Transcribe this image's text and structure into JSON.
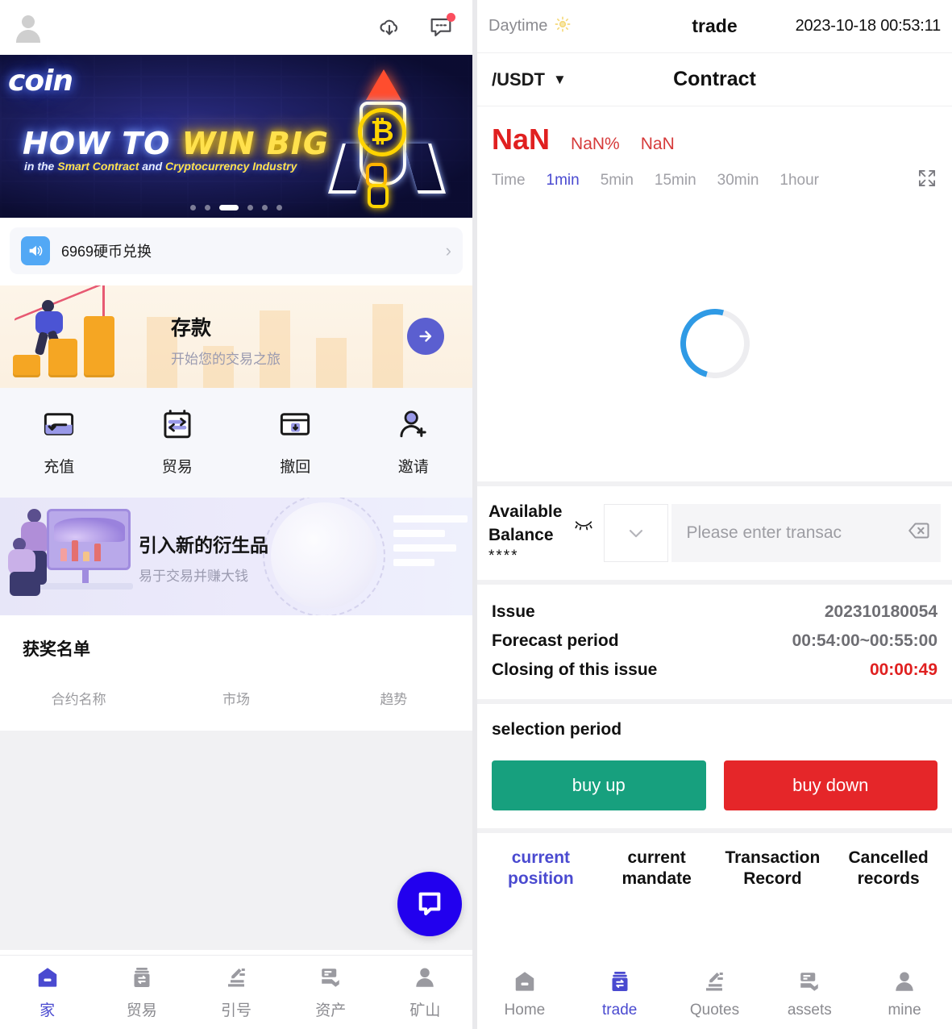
{
  "colors": {
    "brand_indigo": "#4a4ad0",
    "accent_periwinkle": "#9999e8",
    "buy_up_green": "#17a07e",
    "buy_down_red": "#e52629",
    "price_red": "#e02020",
    "fab_blue": "#2200ee",
    "notice_blue": "#52a8f5",
    "spinner_blue": "#2f9ae5"
  },
  "left": {
    "topbar": {
      "avatar_icon": "avatar-icon",
      "download_icon": "cloud-download-icon",
      "message_icon": "message-icon",
      "message_badge": true
    },
    "banner": {
      "logo": "coin",
      "headline_part1": "HOW TO ",
      "headline_highlight": "WIN BIG",
      "subline_pre": "in the ",
      "subline_hl1": "Smart Contract",
      "subline_mid": " and ",
      "subline_hl2": "Cryptocurrency Industry",
      "coin_symbol": "₿",
      "dots_total": 6,
      "dots_active_index": 2
    },
    "notice": {
      "icon": "speaker-icon",
      "text": "6969硬币兑换",
      "chevron": "›"
    },
    "deposit": {
      "title": "存款",
      "subtitle": "开始您的交易之旅",
      "arrow_icon": "arrow-right-icon"
    },
    "quick_actions": [
      {
        "label": "充值",
        "icon": "recharge-icon"
      },
      {
        "label": "贸易",
        "icon": "trade-exchange-icon"
      },
      {
        "label": "撤回",
        "icon": "withdraw-icon"
      },
      {
        "label": "邀请",
        "icon": "invite-user-icon"
      }
    ],
    "derivatives": {
      "title": "引入新的衍生品",
      "subtitle": "易于交易并赚大钱"
    },
    "winners": {
      "title": "获奖名单",
      "columns": [
        "合约名称",
        "市场",
        "趋势"
      ],
      "rows": []
    },
    "fab": {
      "icon": "chat-bubble-icon"
    },
    "bottom_nav": [
      {
        "label": "家",
        "icon": "home-icon",
        "active": true
      },
      {
        "label": "贸易",
        "icon": "trade-icon",
        "active": false
      },
      {
        "label": "引号",
        "icon": "quotes-icon",
        "active": false
      },
      {
        "label": "资产",
        "icon": "assets-icon",
        "active": false
      },
      {
        "label": "矿山",
        "icon": "mine-user-icon",
        "active": false
      }
    ]
  },
  "right": {
    "topbar": {
      "daytime_label": "Daytime",
      "daytime_icon": "sun-icon",
      "title": "trade",
      "datetime": "2023-10-18 00:53:11"
    },
    "subbar": {
      "pair": "/USDT",
      "pair_caret": "▼",
      "contract_label": "Contract"
    },
    "price": {
      "last": "NaN",
      "change_percent": "NaN%",
      "change_amount": "NaN"
    },
    "intervals": {
      "time_label": "Time",
      "items": [
        {
          "label": "1min",
          "active": true
        },
        {
          "label": "5min",
          "active": false
        },
        {
          "label": "15min",
          "active": false
        },
        {
          "label": "30min",
          "active": false
        },
        {
          "label": "1hour",
          "active": false
        }
      ],
      "expand_icon": "expand-fullscreen-icon"
    },
    "chart": {
      "state": "loading",
      "spinner_icon": "loading-spinner-icon"
    },
    "balance": {
      "label_line1": "Available",
      "label_line2": "Balance",
      "masked_value": "****",
      "eye_icon": "eye-closed-icon",
      "select_caret_icon": "chevron-down-icon",
      "input_placeholder": "Please enter transac",
      "clear_icon": "backspace-delete-icon"
    },
    "info": [
      {
        "key": "Issue",
        "value": "202310180054",
        "highlight": false
      },
      {
        "key": "Forecast period",
        "value": "00:54:00~00:55:00",
        "highlight": false
      },
      {
        "key": "Closing of this issue",
        "value": "00:00:49",
        "highlight": true
      }
    ],
    "selection": {
      "title": "selection period",
      "buy_up_label": "buy up",
      "buy_down_label": "buy down"
    },
    "tabs": [
      {
        "line1": "current",
        "line2": "position",
        "active": true
      },
      {
        "line1": "current",
        "line2": "mandate",
        "active": false
      },
      {
        "line1": "Transaction",
        "line2": "Record",
        "active": false
      },
      {
        "line1": "Cancelled",
        "line2": "records",
        "active": false
      }
    ],
    "bottom_nav": [
      {
        "label": "Home",
        "icon": "home-icon",
        "active": false
      },
      {
        "label": "trade",
        "icon": "trade-icon",
        "active": true
      },
      {
        "label": "Quotes",
        "icon": "quotes-icon",
        "active": false
      },
      {
        "label": "assets",
        "icon": "assets-icon",
        "active": false
      },
      {
        "label": "mine",
        "icon": "mine-user-icon",
        "active": false
      }
    ]
  }
}
